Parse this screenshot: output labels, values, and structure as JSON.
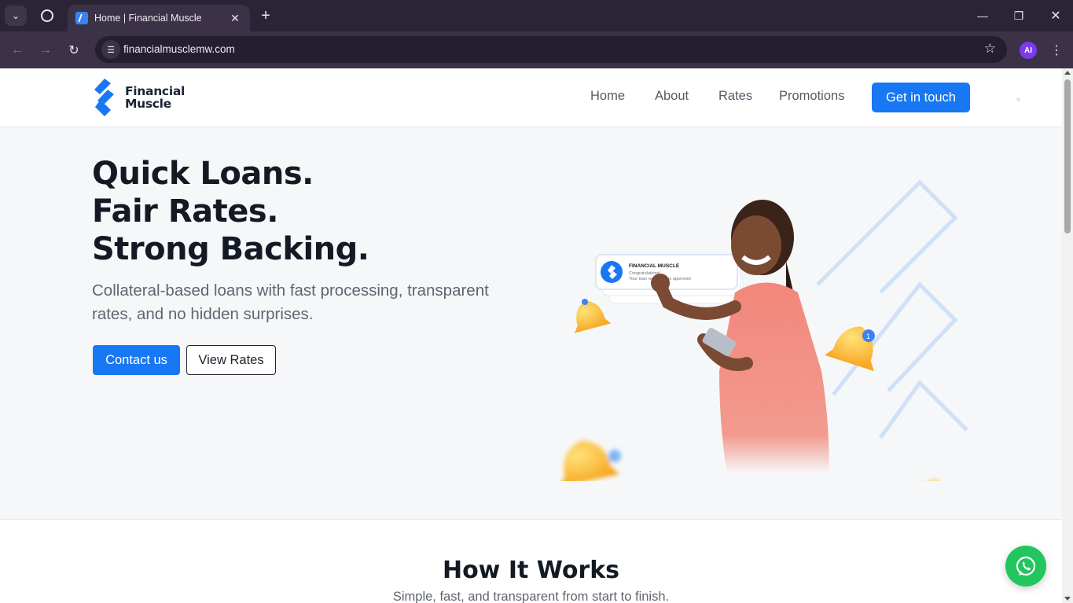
{
  "browser": {
    "tab_title": "Home | Financial Muscle",
    "url": "financialmusclemw.com",
    "profile_initials": "AI"
  },
  "header": {
    "logo_line1": "Financial",
    "logo_line2": "Muscle",
    "nav": [
      "Home",
      "About",
      "Rates",
      "Promotions"
    ],
    "cta": "Get in touch"
  },
  "hero": {
    "title_lines": [
      "Quick Loans.",
      "Fair Rates.",
      "Strong Backing."
    ],
    "subtitle": "Collateral-based loans with fast processing, transparent rates, and no hidden surprises.",
    "primary_button": "Contact us",
    "secondary_button": "View Rates",
    "notification": {
      "brand": "FINANCIAL MUSCLE",
      "line1": "Congratulations!",
      "line2": "Your loan request was approved"
    },
    "bell_badges": [
      "1"
    ]
  },
  "how_it_works": {
    "title": "How It Works",
    "subtitle": "Simple, fast, and transparent from start to finish."
  },
  "colors": {
    "accent": "#1877f2",
    "whatsapp": "#22c55e"
  }
}
